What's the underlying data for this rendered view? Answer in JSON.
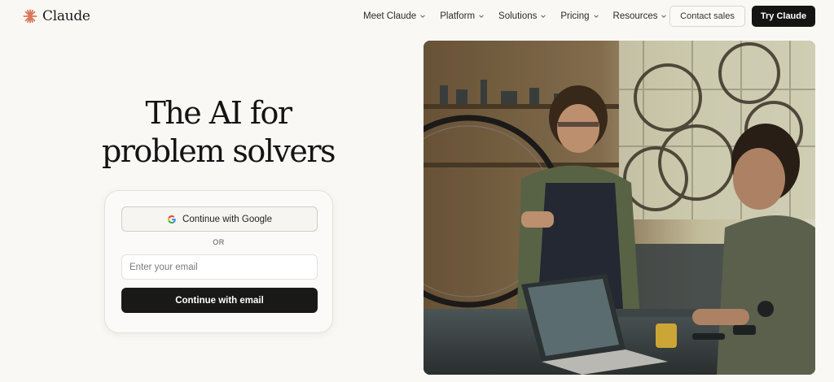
{
  "brand": {
    "name": "Claude",
    "logo_icon": "claude-starburst-icon",
    "accent": "#d97757"
  },
  "nav": {
    "items": [
      {
        "label": "Meet Claude"
      },
      {
        "label": "Platform"
      },
      {
        "label": "Solutions"
      },
      {
        "label": "Pricing"
      },
      {
        "label": "Resources"
      }
    ],
    "contact_label": "Contact sales",
    "try_label": "Try Claude"
  },
  "hero": {
    "title_line1": "The AI for",
    "title_line2": "problem solvers"
  },
  "auth": {
    "google_label": "Continue with Google",
    "google_icon": "google-g-icon",
    "or_label": "OR",
    "email_placeholder": "Enter your email",
    "email_value": "",
    "email_button_label": "Continue with email"
  },
  "colors": {
    "background": "#f9f8f5",
    "primary_button": "#141413",
    "accent": "#d97757"
  }
}
